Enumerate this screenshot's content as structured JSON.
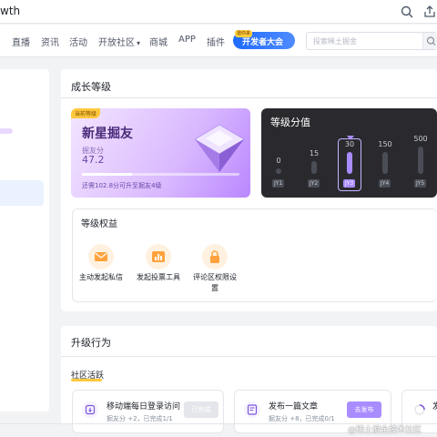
{
  "browser": {
    "url_fragment": "wth",
    "icons": [
      "search-icon",
      "share-icon"
    ]
  },
  "nav": {
    "items": [
      "直播",
      "资讯",
      "活动",
      "开放社区",
      "商城",
      "APP",
      "插件"
    ],
    "caret": "▾",
    "dev_banner": {
      "tag": "邀你来",
      "text": "开发者大会"
    },
    "search_placeholder": "探索稀土掘金"
  },
  "growth": {
    "title": "成长等级",
    "level_card": {
      "badge": "当前等级",
      "name": "新星掘友",
      "score_label": "掘友分",
      "score": "47.2",
      "progress": 0.32,
      "note": "还需102.8分可升至掘友4级"
    },
    "score_card": {
      "title": "等级分值",
      "levels": [
        {
          "label": "JY1",
          "score": "0",
          "active": false
        },
        {
          "label": "JY2",
          "score": "15",
          "active": false
        },
        {
          "label": "JY3",
          "score": "30",
          "active": true
        },
        {
          "label": "JY4",
          "score": "150",
          "active": false
        },
        {
          "label": "JY5",
          "score": "500",
          "active": false
        }
      ]
    },
    "rights": {
      "title": "等级权益",
      "items": [
        {
          "label": "主动发起私信",
          "icon": "mail-icon"
        },
        {
          "label": "发起投票工具",
          "icon": "vote-chart-icon"
        },
        {
          "label": "评论区权限设置",
          "icon": "lock-icon"
        }
      ]
    }
  },
  "upgrade": {
    "title": "升级行为",
    "section": "社区活跃",
    "tasks": [
      {
        "title": "移动端每日登录访问",
        "sub": "掘友分 +2，已完成1/1",
        "button": "已完成",
        "done": true,
        "icon": "login-icon"
      },
      {
        "title": "发布一篇文章",
        "sub": "掘友分 +8，已完成0/1",
        "button": "去发布",
        "done": false,
        "icon": "article-icon"
      },
      {
        "title": "发",
        "sub": "",
        "button": "",
        "done": false,
        "icon": "loading-icon"
      }
    ]
  },
  "watermark": "@稀土掘金技术社区",
  "colors": {
    "accent": "#1e80ff",
    "purple": "#a98cff",
    "gold": "#ffc83d"
  }
}
